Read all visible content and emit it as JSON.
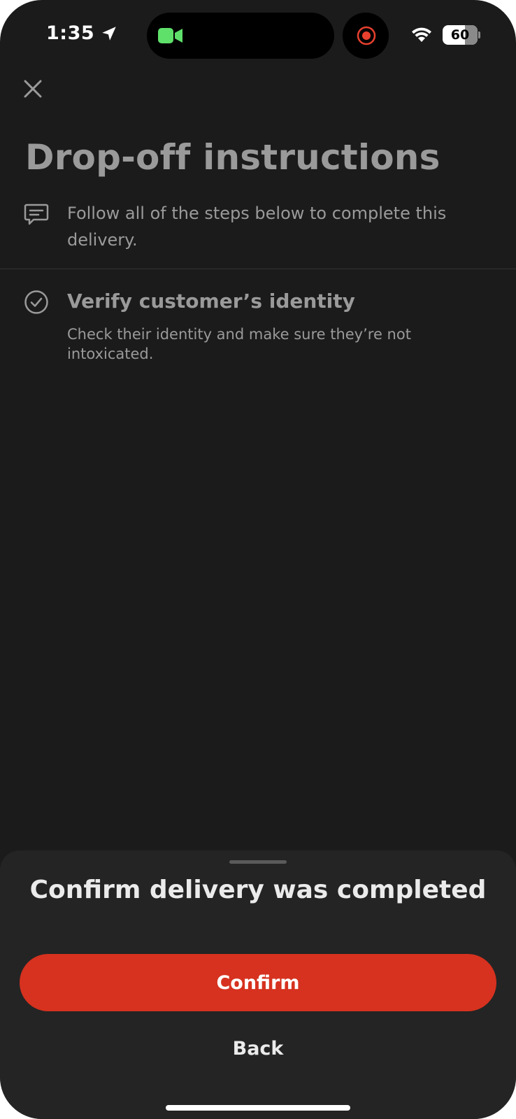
{
  "status_bar": {
    "time": "1:35",
    "battery": "60",
    "icons": [
      "location-arrow-icon",
      "facetime-camera-icon",
      "screen-record-icon",
      "wifi-icon",
      "battery-icon"
    ]
  },
  "header": {
    "close_icon": "close-icon",
    "title": "Drop-off instructions"
  },
  "intro": {
    "icon": "message-icon",
    "text": "Follow all of the steps below to complete this delivery."
  },
  "steps": [
    {
      "icon": "check-circle-icon",
      "title": "Verify customer’s identity",
      "description": "Check their identity and make sure they’re not intoxicated."
    }
  ],
  "sheet": {
    "title": "Confirm delivery was completed",
    "confirm_label": "Confirm",
    "back_label": "Back"
  },
  "colors": {
    "background": "#1b1b1b",
    "sheet": "#242424",
    "accent": "#d6321f",
    "muted_text": "#9a9a9a",
    "facetime_green": "#5fe06b",
    "record_red": "#e8402e"
  }
}
